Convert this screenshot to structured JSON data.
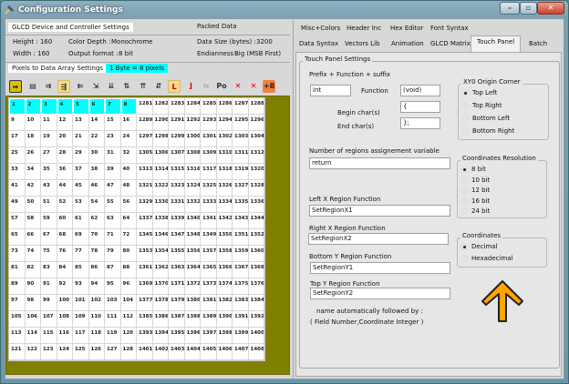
{
  "window": {
    "title": "Configuration Settings",
    "minimize": "–",
    "maximize": "▫",
    "close": "✕"
  },
  "device": {
    "section_label": "GLCD Device and Controller Settings",
    "packed_label": "Packed Data",
    "height": "Height : 160",
    "width": "Width : 160",
    "color_depth_label": "Color Depth :",
    "color_depth": "Monochrome",
    "output_format_label": "Output format :",
    "output_format": "8 bit",
    "data_size_label": "Data Size (bytes) :",
    "data_size": "3200",
    "endianness_label": "Endianness :",
    "endianness": "Big (MSB First)"
  },
  "pixels": {
    "section_label": "Pixels to Data Array Settings",
    "byte_badge": "1 Byte = 8 pixels"
  },
  "toolbar": [
    {
      "icon": "arrow-right-icon",
      "glyph": "➡",
      "selected": false,
      "color": "#d8c000"
    },
    {
      "icon": "memory-icon",
      "glyph": "▤",
      "selected": false,
      "color": "#333"
    },
    {
      "icon": "swap-horizontal-icon",
      "glyph": "⇉",
      "selected": false,
      "color": "#333"
    },
    {
      "icon": "scan-diagonal-icon",
      "glyph": "⇶",
      "selected": true,
      "color": "#333"
    },
    {
      "icon": "scan-left-icon",
      "glyph": "⇇",
      "selected": false,
      "color": "#333"
    },
    {
      "icon": "scan-down-right-icon",
      "glyph": "⇲",
      "selected": false,
      "color": "#333"
    },
    {
      "icon": "scan-down-icon",
      "glyph": "⇊",
      "selected": false,
      "color": "#333"
    },
    {
      "icon": "scan-up-down-icon",
      "glyph": "⇅",
      "selected": false,
      "color": "#333"
    },
    {
      "icon": "scan-up-icon",
      "glyph": "⇈",
      "selected": false,
      "color": "#333"
    },
    {
      "icon": "scan-mixed-icon",
      "glyph": "⇵",
      "selected": false,
      "color": "#333"
    },
    {
      "icon": "bit-order-lsb-icon",
      "glyph": "L",
      "selected": true,
      "color": "#c00000"
    },
    {
      "icon": "bit-order-msb-icon",
      "glyph": "⌋",
      "selected": false,
      "color": "#c00000"
    },
    {
      "icon": "swap-disabled-icon",
      "glyph": "⇆",
      "selected": false,
      "color": "#aaa"
    },
    {
      "icon": "position-icon",
      "glyph": "Po",
      "selected": false,
      "color": "#333"
    },
    {
      "icon": "no-flip-icon",
      "glyph": "✕",
      "selected": false,
      "color": "#d00000"
    },
    {
      "icon": "no-rotate-icon",
      "glyph": "✕",
      "selected": false,
      "color": "#d00000"
    },
    {
      "icon": "plus-eight-icon",
      "glyph": "+8",
      "selected": false,
      "color": "#f08040"
    }
  ],
  "grid": {
    "highlight_color": "#00ffff",
    "frame_color": "#808000",
    "rows": [
      [
        1,
        2,
        3,
        4,
        5,
        6,
        7,
        8,
        1281,
        1282,
        1283,
        1284,
        1285,
        1286,
        1287,
        1288
      ],
      [
        9,
        10,
        11,
        12,
        13,
        14,
        15,
        16,
        1289,
        1290,
        1291,
        1292,
        1293,
        1294,
        1295,
        1296
      ],
      [
        17,
        18,
        19,
        20,
        21,
        22,
        23,
        24,
        1297,
        1298,
        1299,
        1300,
        1301,
        1302,
        1303,
        1304
      ],
      [
        25,
        26,
        27,
        28,
        29,
        30,
        31,
        32,
        1305,
        1306,
        1307,
        1308,
        1309,
        1310,
        1311,
        1312
      ],
      [
        33,
        34,
        35,
        36,
        37,
        38,
        39,
        40,
        1313,
        1314,
        1315,
        1316,
        1317,
        1318,
        1319,
        1320
      ],
      [
        41,
        42,
        43,
        44,
        45,
        46,
        47,
        48,
        1321,
        1322,
        1323,
        1324,
        1325,
        1326,
        1327,
        1328
      ],
      [
        49,
        50,
        51,
        52,
        53,
        54,
        55,
        56,
        1329,
        1330,
        1331,
        1332,
        1333,
        1334,
        1335,
        1336
      ],
      [
        57,
        58,
        59,
        60,
        61,
        62,
        63,
        64,
        1337,
        1338,
        1339,
        1340,
        1341,
        1342,
        1343,
        1344
      ],
      [
        65,
        66,
        67,
        68,
        69,
        70,
        71,
        72,
        1345,
        1346,
        1347,
        1348,
        1349,
        1350,
        1351,
        1352
      ],
      [
        73,
        74,
        75,
        76,
        77,
        78,
        79,
        80,
        1353,
        1354,
        1355,
        1356,
        1357,
        1358,
        1359,
        1360
      ],
      [
        81,
        82,
        83,
        84,
        85,
        86,
        87,
        88,
        1361,
        1362,
        1363,
        1364,
        1365,
        1366,
        1367,
        1368
      ],
      [
        89,
        90,
        91,
        92,
        93,
        94,
        95,
        96,
        1369,
        1370,
        1371,
        1372,
        1373,
        1374,
        1375,
        1376
      ],
      [
        97,
        98,
        99,
        100,
        101,
        102,
        103,
        104,
        1377,
        1378,
        1379,
        1380,
        1381,
        1382,
        1383,
        1384
      ],
      [
        105,
        106,
        107,
        108,
        109,
        110,
        111,
        112,
        1385,
        1386,
        1387,
        1388,
        1389,
        1390,
        1391,
        1392
      ],
      [
        113,
        114,
        115,
        116,
        117,
        118,
        119,
        120,
        1393,
        1394,
        1395,
        1396,
        1397,
        1398,
        1399,
        1400
      ],
      [
        121,
        122,
        123,
        124,
        125,
        126,
        127,
        128,
        1401,
        1402,
        1403,
        1404,
        1405,
        1406,
        1407,
        1408
      ]
    ],
    "highlighted_cells": 8
  },
  "tabs": {
    "row1": [
      "Misc+Colors",
      "Header Inc",
      "Hex Editor",
      "Font Syntax"
    ],
    "row2": [
      "Data Syntax",
      "Vectors Lib",
      "Animation",
      "GLCD Matrix",
      "Touch Panel",
      "Batch"
    ],
    "active": "Touch Panel"
  },
  "touch": {
    "group_title": "Touch Panel Settings",
    "prefix_label": "Prefix + Function + suffix",
    "prefix_value": "int",
    "function_label": "Function",
    "function_value": "(void)",
    "begin_label": "Begin char(s)",
    "begin_value": "{",
    "end_label": "End char(s)",
    "end_value": "};",
    "regions_label": "Number of regions assignement variable",
    "regions_value": "return",
    "left_x_label": "Left X Region Function",
    "left_x_value": "SetRegionX1",
    "right_x_label": "Right X Region Function",
    "right_x_value": "SetRegionX2",
    "bottom_y_label": "Bottom Y Region Function",
    "bottom_y_value": "SetRegionY1",
    "top_y_label": "Top Y Region Function",
    "top_y_value": "SetRegionY2",
    "note1": "name automatically followed by :",
    "note2": "( Field Number,Coordinate Integer )",
    "origin": {
      "title": "XY0 Origin Corner",
      "options": [
        "Top Left",
        "Top Right",
        "Bottom Left",
        "Bottom Right"
      ],
      "selected": "Top Left"
    },
    "resolution": {
      "title": "Coordinates Resolution",
      "options": [
        "8 bit",
        "10 bit",
        "12 bit",
        "16 bit",
        "24 bit"
      ],
      "selected": "8 bit"
    },
    "coordinates": {
      "title": "Coordinates",
      "options": [
        "Decimal",
        "Hexadecimal"
      ],
      "selected": "Decimal"
    },
    "arrow_color": "#ffa500"
  }
}
